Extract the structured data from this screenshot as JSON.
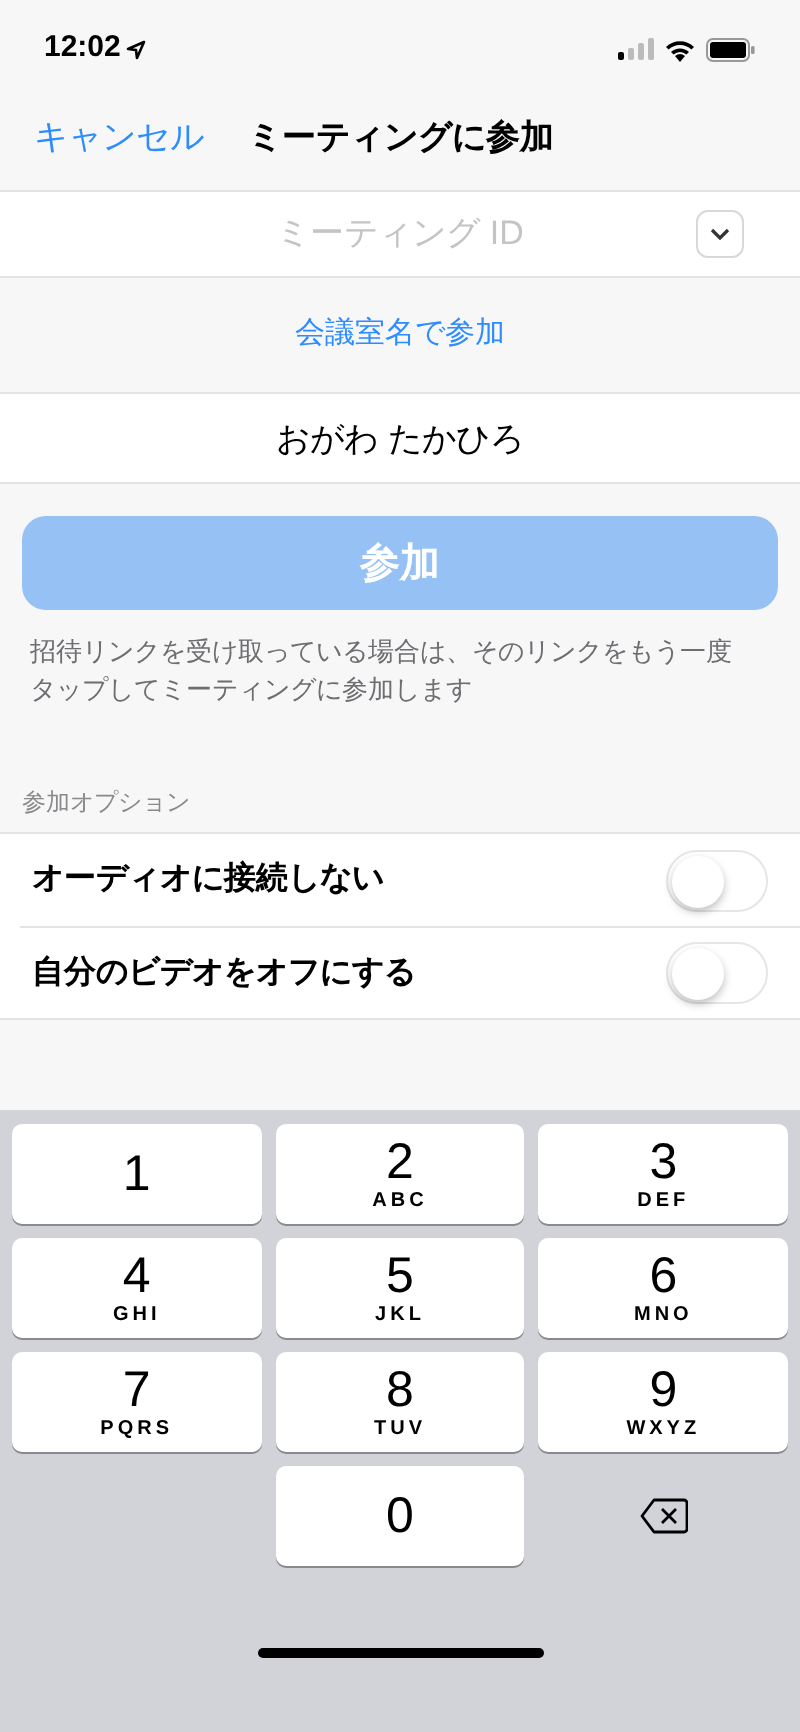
{
  "status_bar": {
    "time": "12:02"
  },
  "nav": {
    "cancel": "キャンセル",
    "title": "ミーティングに参加"
  },
  "meeting_id": {
    "placeholder": "ミーティング ID"
  },
  "join_by_room": "会議室名で参加",
  "name_field": {
    "value": "おがわ たかひろ"
  },
  "join_button": {
    "label": "参加",
    "disabled": true
  },
  "hint": "招待リンクを受け取っている場合は、そのリンクをもう一度タップしてミーティングに参加します",
  "options": {
    "header": "参加オプション",
    "items": [
      {
        "label": "オーディオに接続しない",
        "on": false
      },
      {
        "label": "自分のビデオをオフにする",
        "on": false
      }
    ]
  },
  "keypad": [
    {
      "digit": "1"
    },
    {
      "digit": "2",
      "letters": "ABC"
    },
    {
      "digit": "3",
      "letters": "DEF"
    },
    {
      "digit": "4",
      "letters": "GHI"
    },
    {
      "digit": "5",
      "letters": "JKL"
    },
    {
      "digit": "6",
      "letters": "MNO"
    },
    {
      "digit": "7",
      "letters": "PQRS"
    },
    {
      "digit": "8",
      "letters": "TUV"
    },
    {
      "digit": "9",
      "letters": "WXYZ"
    },
    {
      "digit": "0"
    }
  ]
}
